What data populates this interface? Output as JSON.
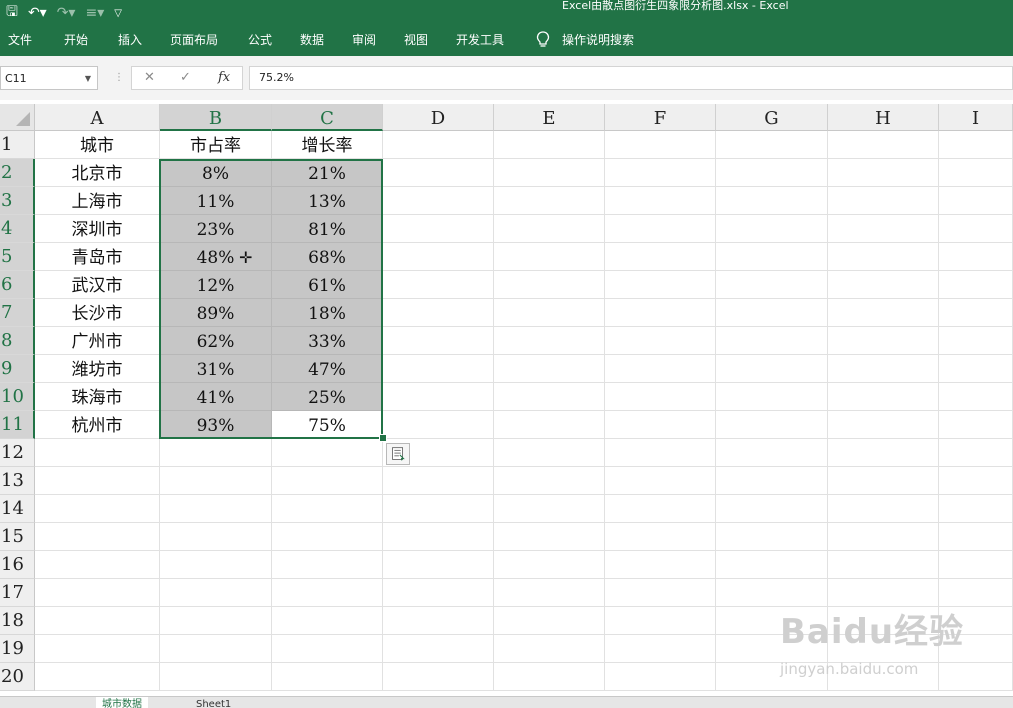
{
  "window": {
    "title": "Excel由散点图衍生四象限分析图.xlsx  -  Excel"
  },
  "ribbon": {
    "tabs": [
      "文件",
      "开始",
      "插入",
      "页面布局",
      "公式",
      "数据",
      "审阅",
      "视图",
      "开发工具"
    ],
    "tell_me": "操作说明搜索"
  },
  "formula_bar": {
    "name_box": "C11",
    "fx": "fx",
    "value": "75.2%"
  },
  "sheet": {
    "columns": [
      "A",
      "B",
      "C",
      "D",
      "E",
      "F",
      "G",
      "H",
      "I"
    ],
    "rows": [
      "1",
      "2",
      "3",
      "4",
      "5",
      "6",
      "7",
      "8",
      "9",
      "10",
      "11",
      "12",
      "13",
      "14",
      "15",
      "16",
      "17",
      "18",
      "19",
      "20"
    ],
    "headers": [
      "城市",
      "市占率",
      "增长率"
    ],
    "data": [
      [
        "北京市",
        "8%",
        "21%"
      ],
      [
        "上海市",
        "11%",
        "13%"
      ],
      [
        "深圳市",
        "23%",
        "81%"
      ],
      [
        "青岛市",
        "48%",
        "68%"
      ],
      [
        "武汉市",
        "12%",
        "61%"
      ],
      [
        "长沙市",
        "89%",
        "18%"
      ],
      [
        "广州市",
        "62%",
        "33%"
      ],
      [
        "潍坊市",
        "31%",
        "47%"
      ],
      [
        "珠海市",
        "41%",
        "25%"
      ],
      [
        "杭州市",
        "93%",
        "75%"
      ]
    ],
    "selection": "B2:C11",
    "active_cell": "C11"
  },
  "sheet_tabs": [
    "城市数据",
    "Sheet1"
  ],
  "watermark": {
    "logo": "Baidu经验",
    "url": "jingyan.baidu.com"
  },
  "colors": {
    "accent": "#217346",
    "selection_fill": "#c6c6c6"
  }
}
